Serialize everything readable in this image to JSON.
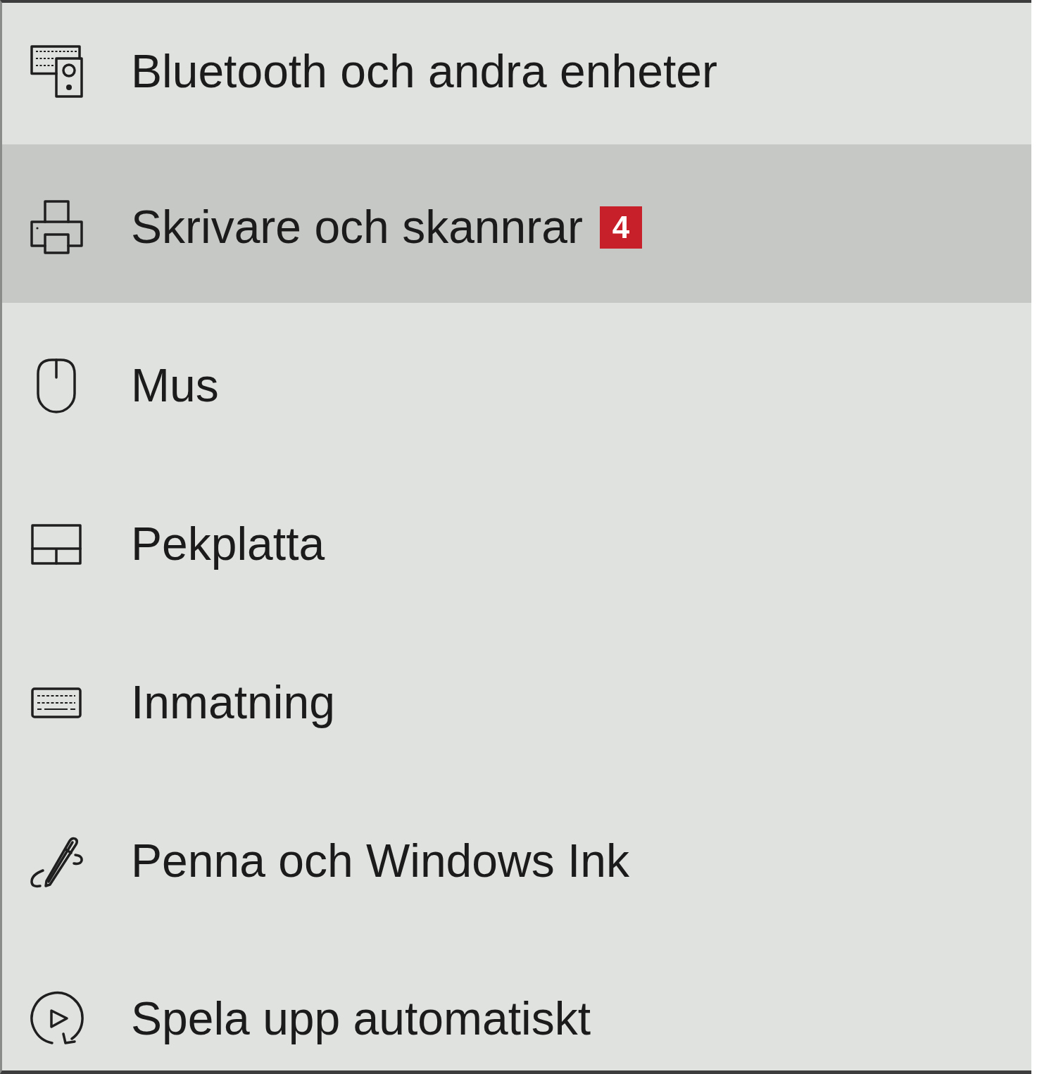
{
  "items": [
    {
      "label": "Bluetooth och andra enheter",
      "kind": "devices",
      "selected": false
    },
    {
      "label": "Skrivare och skannrar",
      "kind": "printer",
      "selected": true,
      "badge": "4"
    },
    {
      "label": "Mus",
      "kind": "mouse",
      "selected": false
    },
    {
      "label": "Pekplatta",
      "kind": "touchpad",
      "selected": false
    },
    {
      "label": "Inmatning",
      "kind": "keyboard",
      "selected": false
    },
    {
      "label": "Penna och Windows Ink",
      "kind": "pen",
      "selected": false
    },
    {
      "label": "Spela upp automatiskt",
      "kind": "autoplay",
      "selected": false
    }
  ]
}
